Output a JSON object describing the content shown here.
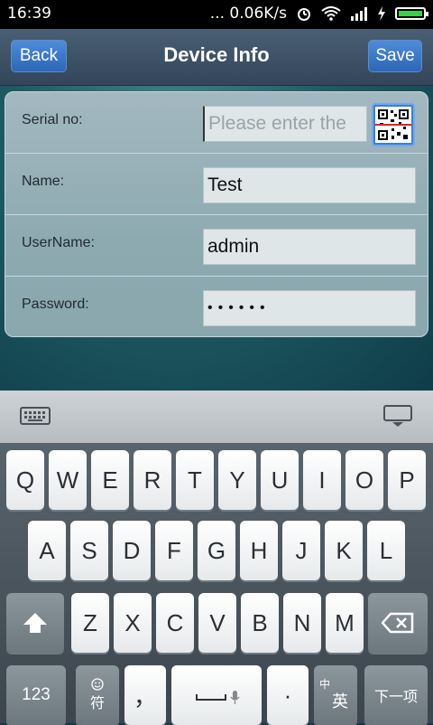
{
  "status_bar": {
    "time": "16:39",
    "network_speed": "... 0.06K/s",
    "icons": [
      "alarm-icon",
      "wifi-icon",
      "signal-icon",
      "charging-icon",
      "battery-icon"
    ]
  },
  "nav": {
    "back_label": "Back",
    "title": "Device Info",
    "save_label": "Save"
  },
  "form": {
    "serial": {
      "label": "Serial no:",
      "placeholder": "Please enter the",
      "value": ""
    },
    "name": {
      "label": "Name:",
      "value": "Test"
    },
    "username": {
      "label": "UserName:",
      "value": "admin"
    },
    "password": {
      "label": "Password:",
      "masked_value": "••••••"
    }
  },
  "keyboard": {
    "row1": [
      "Q",
      "W",
      "E",
      "R",
      "T",
      "Y",
      "U",
      "I",
      "O",
      "P"
    ],
    "row2": [
      "A",
      "S",
      "D",
      "F",
      "G",
      "H",
      "J",
      "K",
      "L"
    ],
    "row3": [
      "Z",
      "X",
      "C",
      "V",
      "B",
      "N",
      "M"
    ],
    "bottom": {
      "num_label": "123",
      "symbol_label": "符",
      "comma_label": "，",
      "period_label": "·",
      "lang_zh": "中",
      "lang_en": "英",
      "next_label": "下一项"
    }
  },
  "colors": {
    "accent_blue": "#3a7fd8",
    "nav_bg": "#3e5267",
    "battery_green": "#3ccf4a"
  }
}
